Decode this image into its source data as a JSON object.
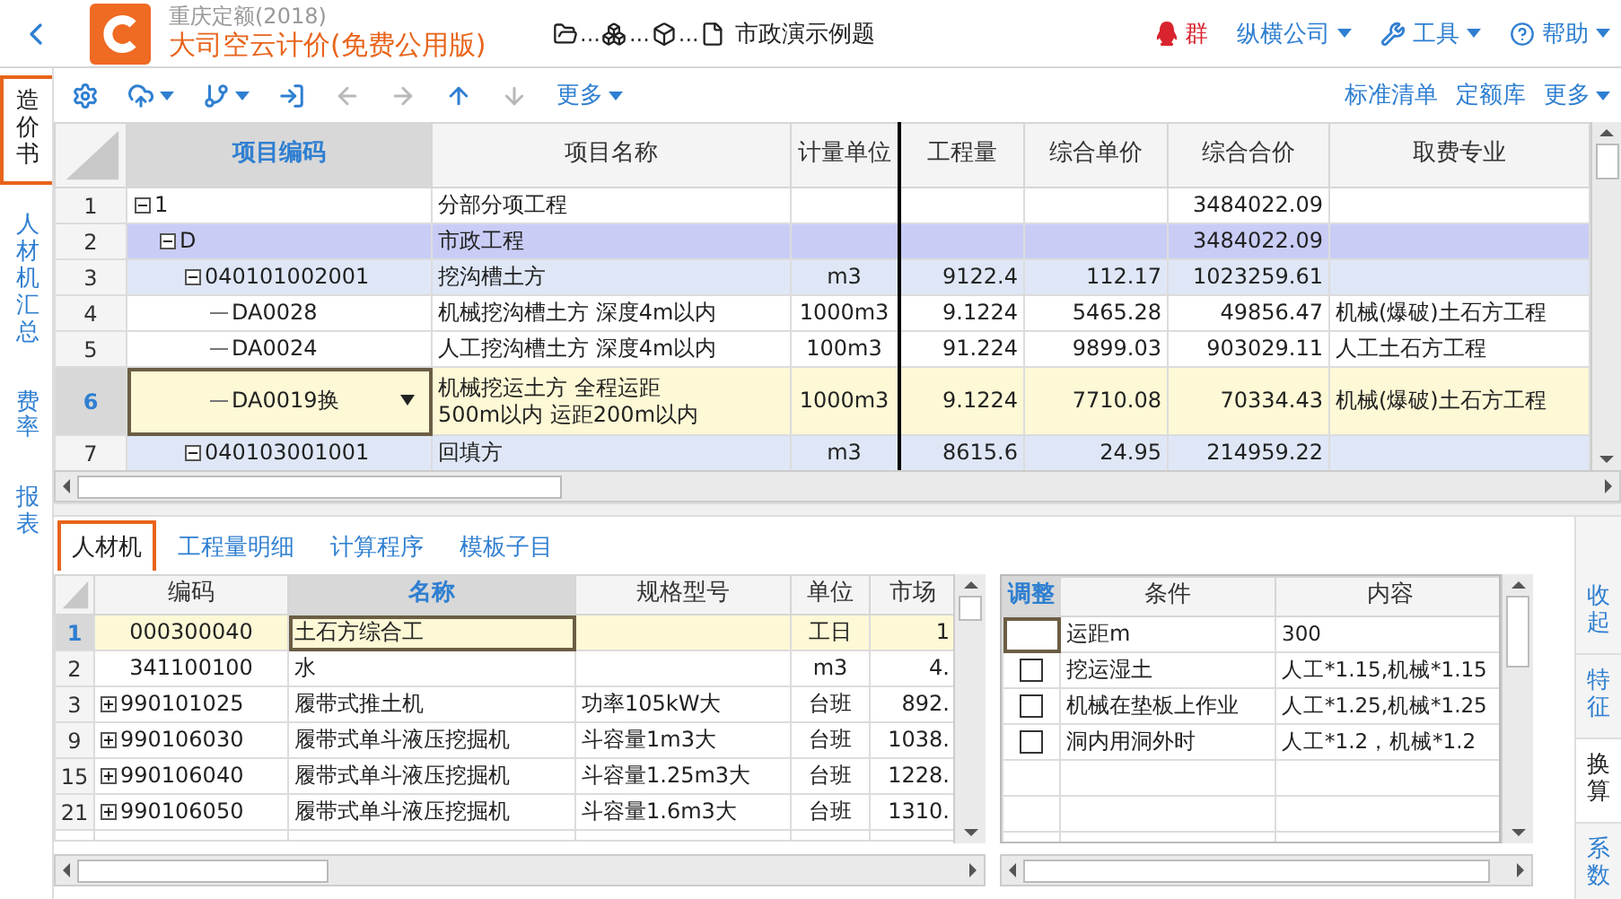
{
  "app": {
    "subtitle": "重庆定额(2018)",
    "title": "大司空云计价(免费公用版)",
    "path": [
      "...",
      "...",
      "..."
    ],
    "project": "市政演示例题"
  },
  "menu": [
    {
      "kind": "qq",
      "label": "群",
      "dropdown": false
    },
    {
      "kind": "company",
      "label": "纵横公司",
      "dropdown": true
    },
    {
      "kind": "tools",
      "label": "工具",
      "dropdown": true
    },
    {
      "kind": "help",
      "label": "帮助",
      "dropdown": true
    }
  ],
  "side_tabs": [
    {
      "label": "造价书",
      "selected": true
    },
    {
      "label": "人材机汇总",
      "selected": false
    },
    {
      "label": "费率",
      "selected": false
    },
    {
      "label": "报表",
      "selected": false
    }
  ],
  "toolbar": {
    "tools": [
      {
        "kind": "settings",
        "disabled": false,
        "dropdown": false
      },
      {
        "kind": "upload",
        "disabled": false,
        "dropdown": true
      },
      {
        "kind": "branch",
        "disabled": false,
        "dropdown": true
      },
      {
        "kind": "import",
        "disabled": false,
        "dropdown": false
      },
      {
        "kind": "left",
        "disabled": true,
        "dropdown": false
      },
      {
        "kind": "right",
        "disabled": true,
        "dropdown": false
      },
      {
        "kind": "up",
        "disabled": false,
        "dropdown": false
      },
      {
        "kind": "down",
        "disabled": true,
        "dropdown": false
      }
    ],
    "more": {
      "label": "更多",
      "dropdown": true
    },
    "links": [
      {
        "label": "标准清单",
        "dropdown": false
      },
      {
        "label": "定额库",
        "dropdown": false
      },
      {
        "label": "更多",
        "dropdown": true
      }
    ]
  },
  "bill_grid": {
    "columns": [
      {
        "label": "项目编码",
        "selected": true
      },
      {
        "label": "项目名称",
        "selected": false
      },
      {
        "label": "计量单位",
        "selected": false
      },
      {
        "label": "工程量",
        "selected": false
      },
      {
        "label": "综合单价",
        "selected": false
      },
      {
        "label": "综合合价",
        "selected": false
      },
      {
        "label": "取费专业",
        "selected": false
      }
    ],
    "rows": [
      {
        "no": "1",
        "code": "1",
        "name": "分部分项工程",
        "total": "3484022.09",
        "color": "#ffffff",
        "selected": false,
        "expanded": true,
        "children": [
          {
            "no": "2",
            "code": "D",
            "name": "市政工程",
            "total": "3484022.09",
            "color": "#c9cdf6",
            "selected": false,
            "expanded": true,
            "children": [
              {
                "no": "3",
                "code": "040101002001",
                "name": "挖沟槽土方",
                "unit": "m3",
                "qty": "9122.4",
                "price": "112.17",
                "total": "1023259.61",
                "color": "#dfe7f7",
                "selected": false,
                "expanded": true,
                "children": [
                  {
                    "no": "4",
                    "code": "DA0028",
                    "name": "机械挖沟槽土方 深度4m以内",
                    "unit": "1000m3",
                    "qty": "9.1224",
                    "price": "5465.28",
                    "total": "49856.47",
                    "fee": "机械(爆破)土石方工程",
                    "color": "#ffffff",
                    "selected": false
                  },
                  {
                    "no": "5",
                    "code": "DA0024",
                    "name": "人工挖沟槽土方 深度4m以内",
                    "unit": "100m3",
                    "qty": "91.224",
                    "price": "9899.03",
                    "total": "903029.11",
                    "fee": "人工土石方工程",
                    "color": "#ffffff",
                    "selected": false
                  },
                  {
                    "no": "6",
                    "code": "DA0019换",
                    "name": "机械挖运土方 全程运距500m以内 运距200m以内",
                    "unit": "1000m3",
                    "qty": "9.1224",
                    "price": "7710.08",
                    "total": "70334.43",
                    "fee": "机械(爆破)土石方工程",
                    "color": "#fdf8d5",
                    "selected": true
                  }
                ]
              },
              {
                "no": "7",
                "code": "040103001001",
                "name": "回填方",
                "unit": "m3",
                "qty": "8615.6",
                "price": "24.95",
                "total": "214959.22",
                "color": "#dfe7f7",
                "selected": false,
                "expanded": true
              }
            ]
          }
        ]
      }
    ]
  },
  "detail_tabs": [
    {
      "label": "人材机",
      "selected": true
    },
    {
      "label": "工程量明细",
      "selected": false
    },
    {
      "label": "计算程序",
      "selected": false
    },
    {
      "label": "模板子目",
      "selected": false
    }
  ],
  "resource_grid": {
    "columns": [
      {
        "label": "编码",
        "selected": false
      },
      {
        "label": "名称",
        "selected": true
      },
      {
        "label": "规格型号",
        "selected": false
      },
      {
        "label": "单位",
        "selected": false
      },
      {
        "label": "市场",
        "selected": false
      }
    ],
    "rows": [
      {
        "no": "1",
        "code": "000300040",
        "name": "土石方综合工",
        "unit": "工日",
        "price": "1",
        "selected": true
      },
      {
        "no": "2",
        "code": "341100100",
        "name": "水",
        "unit": "m3",
        "price": "4.",
        "selected": false
      },
      {
        "no": "3",
        "code": "990101025",
        "name": "履带式推土机",
        "spec": "功率105kW大",
        "unit": "台班",
        "price": "892.",
        "selected": false,
        "expanded": false
      },
      {
        "no": "9",
        "code": "990106030",
        "name": "履带式单斗液压挖掘机",
        "spec": "斗容量1m3大",
        "unit": "台班",
        "price": "1038.",
        "selected": false,
        "expanded": false
      },
      {
        "no": "15",
        "code": "990106040",
        "name": "履带式单斗液压挖掘机",
        "spec": "斗容量1.25m3大",
        "unit": "台班",
        "price": "1228.",
        "selected": false,
        "expanded": false
      },
      {
        "no": "21",
        "code": "990106050",
        "name": "履带式单斗液压挖掘机",
        "spec": "斗容量1.6m3大",
        "unit": "台班",
        "price": "1310.",
        "selected": false,
        "expanded": false
      }
    ]
  },
  "adjust_grid": {
    "columns": [
      {
        "label": "调整",
        "selected": true
      },
      {
        "label": "条件",
        "selected": false
      },
      {
        "label": "内容",
        "selected": false
      }
    ],
    "rows": [
      {
        "kind": "value",
        "condition": "运距m",
        "content": "300"
      },
      {
        "kind": "option",
        "checked": false,
        "condition": "挖运湿土",
        "content": "人工*1.15,机械*1.15"
      },
      {
        "kind": "option",
        "checked": false,
        "condition": "机械在垫板上作业",
        "content": "人工*1.25,机械*1.25"
      },
      {
        "kind": "option",
        "checked": false,
        "condition": "洞内用洞外时",
        "content": "人工*1.2，机械*1.2"
      }
    ]
  },
  "right_tabs": [
    {
      "label": "收起",
      "selected": false
    },
    {
      "label": "特征",
      "selected": false
    },
    {
      "label": "换算",
      "selected": true
    },
    {
      "label": "系数",
      "selected": false
    }
  ]
}
